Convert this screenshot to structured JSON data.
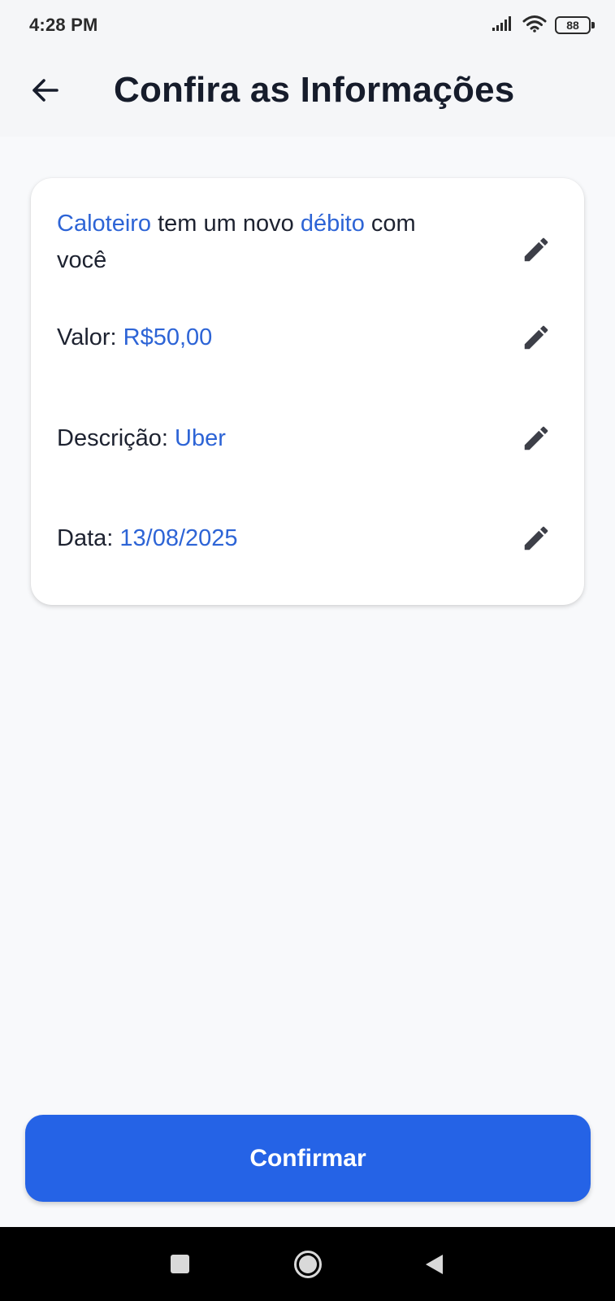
{
  "status_bar": {
    "time": "4:28 PM",
    "battery": "88",
    "icons": [
      "signal-icon",
      "wifi-icon",
      "battery-icon"
    ]
  },
  "app_bar": {
    "title": "Confira as Informações",
    "back_icon": "arrow-left-icon"
  },
  "card": {
    "header": {
      "name": "Caloteiro",
      "text_middle": " tem um novo ",
      "keyword": "débito",
      "text_end": " com você"
    },
    "fields": [
      {
        "label": "Valor: ",
        "value": "R$50,00"
      },
      {
        "label": "Descrição: ",
        "value": "Uber"
      },
      {
        "label": "Data: ",
        "value": "13/08/2025"
      }
    ],
    "edit_icon": "pencil-icon"
  },
  "actions": {
    "confirm_label": "Confirmar"
  },
  "nav_bar": {
    "icons": [
      "recents-square-icon",
      "home-circle-icon",
      "back-triangle-icon"
    ]
  },
  "colors": {
    "accent": "#2d64d6",
    "button": "#2563e6",
    "background": "#f8f9fb",
    "text": "#1d2230"
  }
}
